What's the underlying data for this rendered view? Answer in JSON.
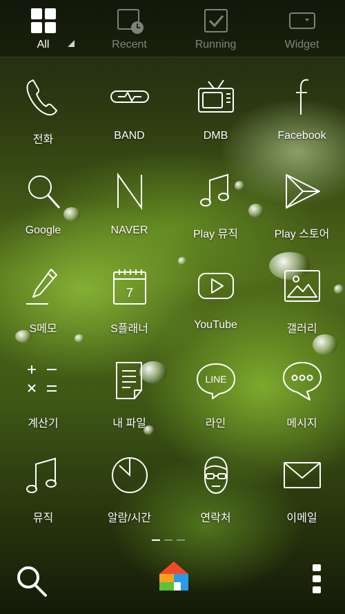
{
  "tabs": [
    {
      "label": "All",
      "icon": "grid-icon",
      "active": true
    },
    {
      "label": "Recent",
      "icon": "recent-clock-icon",
      "active": false
    },
    {
      "label": "Running",
      "icon": "running-check-icon",
      "active": false
    },
    {
      "label": "Widget",
      "icon": "widget-icon",
      "active": false
    }
  ],
  "apps": [
    {
      "label": "전화",
      "icon": "phone-icon"
    },
    {
      "label": "BAND",
      "icon": "band-icon"
    },
    {
      "label": "DMB",
      "icon": "tv-icon"
    },
    {
      "label": "Facebook",
      "icon": "facebook-icon"
    },
    {
      "label": "Google",
      "icon": "google-search-icon"
    },
    {
      "label": "NAVER",
      "icon": "naver-icon"
    },
    {
      "label": "Play 뮤직",
      "icon": "music-note-icon"
    },
    {
      "label": "Play 스토어",
      "icon": "play-store-icon"
    },
    {
      "label": "S메모",
      "icon": "pen-icon"
    },
    {
      "label": "S플래너",
      "icon": "calendar-icon"
    },
    {
      "label": "YouTube",
      "icon": "youtube-icon"
    },
    {
      "label": "갤러리",
      "icon": "gallery-icon"
    },
    {
      "label": "계산기",
      "icon": "calculator-icon"
    },
    {
      "label": "내 파일",
      "icon": "file-icon"
    },
    {
      "label": "라인",
      "icon": "line-icon"
    },
    {
      "label": "메시지",
      "icon": "message-icon"
    },
    {
      "label": "뮤직",
      "icon": "music-icon"
    },
    {
      "label": "알람/시간",
      "icon": "clock-icon"
    },
    {
      "label": "연락처",
      "icon": "contact-face-icon"
    },
    {
      "label": "이메일",
      "icon": "envelope-icon"
    }
  ],
  "icon_text": {
    "calendar_day": "7",
    "line": "LINE"
  },
  "pager": {
    "pages": 3,
    "current": 1
  },
  "dock": {
    "search_icon": "search-icon",
    "home_icon": "home-launcher-icon",
    "menu_icon": "overflow-menu-icon"
  },
  "colors": {
    "home_red": "#f04a2a",
    "home_orange": "#f7a21b",
    "home_green": "#5cc23b",
    "home_blue": "#2a9be6"
  }
}
